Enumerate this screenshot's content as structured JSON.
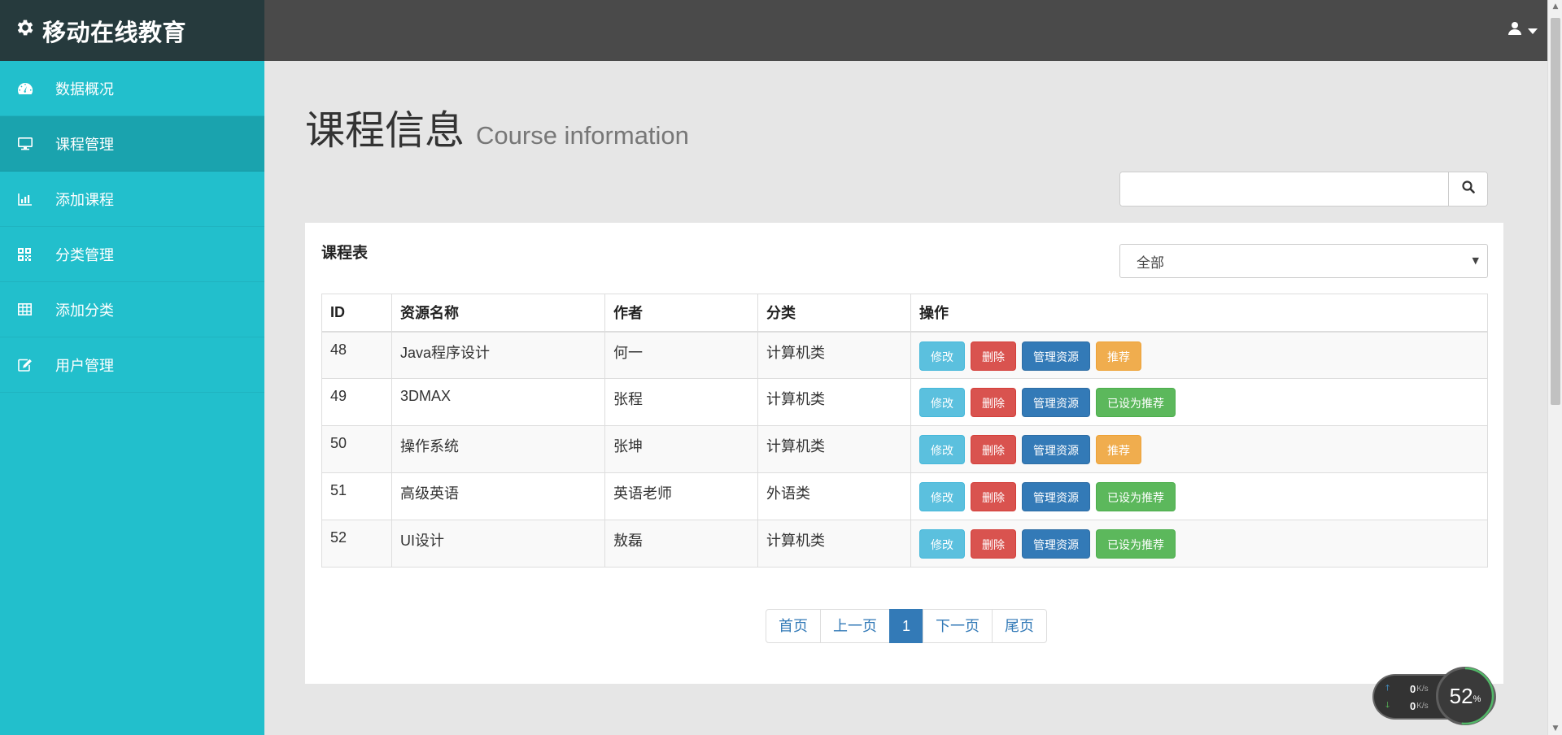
{
  "brand": {
    "title": "移动在线教育"
  },
  "sidebar": {
    "items": [
      {
        "label": "数据概况",
        "icon": "dashboard-icon",
        "active": false
      },
      {
        "label": "课程管理",
        "icon": "monitor-icon",
        "active": true
      },
      {
        "label": "添加课程",
        "icon": "bar-chart-icon",
        "active": false
      },
      {
        "label": "分类管理",
        "icon": "qrcode-icon",
        "active": false
      },
      {
        "label": "添加分类",
        "icon": "table-icon",
        "active": false
      },
      {
        "label": "用户管理",
        "icon": "edit-icon",
        "active": false
      }
    ]
  },
  "topbar": {
    "user_icon": "user-icon"
  },
  "page": {
    "title": "课程信息",
    "subtitle": "Course information"
  },
  "search": {
    "value": "",
    "placeholder": ""
  },
  "panel": {
    "title": "课程表",
    "filter_selected": "全部"
  },
  "table": {
    "headers": [
      "ID",
      "资源名称",
      "作者",
      "分类",
      "操作"
    ],
    "rows": [
      {
        "id": "48",
        "name": "Java程序设计",
        "author": "何一",
        "category": "计算机类",
        "recommend_label": "推荐",
        "recommended": false
      },
      {
        "id": "49",
        "name": "3DMAX",
        "author": "张程",
        "category": "计算机类",
        "recommend_label": "已设为推荐",
        "recommended": true
      },
      {
        "id": "50",
        "name": "操作系统",
        "author": "张坤",
        "category": "计算机类",
        "recommend_label": "推荐",
        "recommended": false
      },
      {
        "id": "51",
        "name": "高级英语",
        "author": "英语老师",
        "category": "外语类",
        "recommend_label": "已设为推荐",
        "recommended": true
      },
      {
        "id": "52",
        "name": "UI设计",
        "author": "敖磊",
        "category": "计算机类",
        "recommend_label": "已设为推荐",
        "recommended": true
      }
    ],
    "actions": {
      "edit": "修改",
      "delete": "删除",
      "manage": "管理资源"
    }
  },
  "pagination": {
    "first": "首页",
    "prev": "上一页",
    "current": "1",
    "next": "下一页",
    "last": "尾页"
  },
  "net_widget": {
    "up_value": "0",
    "down_value": "0",
    "unit": "K/s",
    "percent": "52",
    "percent_sign": "%"
  },
  "colors": {
    "sidebar": "#22bfcc",
    "sidebar_active": "#1aa3ae",
    "brand_bg": "#263a3d",
    "topbar": "#4a4a4a",
    "primary": "#337ab7"
  }
}
